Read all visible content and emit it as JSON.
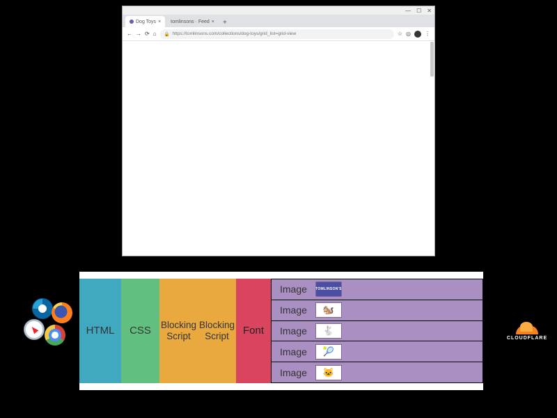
{
  "browser": {
    "window_controls": {
      "min": "—",
      "max": "☐",
      "close": "✕"
    },
    "tabs": [
      {
        "favicon": true,
        "title": "Dog Toys",
        "close": "×"
      },
      {
        "favicon": false,
        "title": "tomlinsons · Feed",
        "close": "×"
      }
    ],
    "newtab": "+",
    "nav": {
      "back": "←",
      "fwd": "→",
      "reload": "⟳",
      "home": "⌂"
    },
    "url_lock": "🔒",
    "url": "https://tomlinsons.com/collections/dog-toys/grid_list=grid-view",
    "right": {
      "star": "☆",
      "ext": "◎",
      "menu": "⋮"
    }
  },
  "waterfall": {
    "blocks": [
      {
        "label": "HTML",
        "kind": "html"
      },
      {
        "label": "CSS",
        "kind": "css"
      },
      {
        "label": "Blocking\nScript",
        "kind": "script"
      },
      {
        "label": "Blocking\nScript",
        "kind": "script"
      },
      {
        "label": "Font",
        "kind": "font"
      }
    ],
    "images": [
      {
        "label": "Image",
        "thumb_type": "logo",
        "thumb_text": "TOMLINSON'S"
      },
      {
        "label": "Image",
        "thumb_type": "emoji",
        "thumb_text": "🐿️"
      },
      {
        "label": "Image",
        "thumb_type": "emoji",
        "thumb_text": "🐇"
      },
      {
        "label": "Image",
        "thumb_type": "emoji",
        "thumb_text": "🎾"
      },
      {
        "label": "Image",
        "thumb_type": "emoji",
        "thumb_text": "🐱"
      }
    ]
  },
  "vendors": [
    "edge",
    "firefox",
    "safari",
    "chrome"
  ],
  "cloudflare": "CLOUDFLARE"
}
